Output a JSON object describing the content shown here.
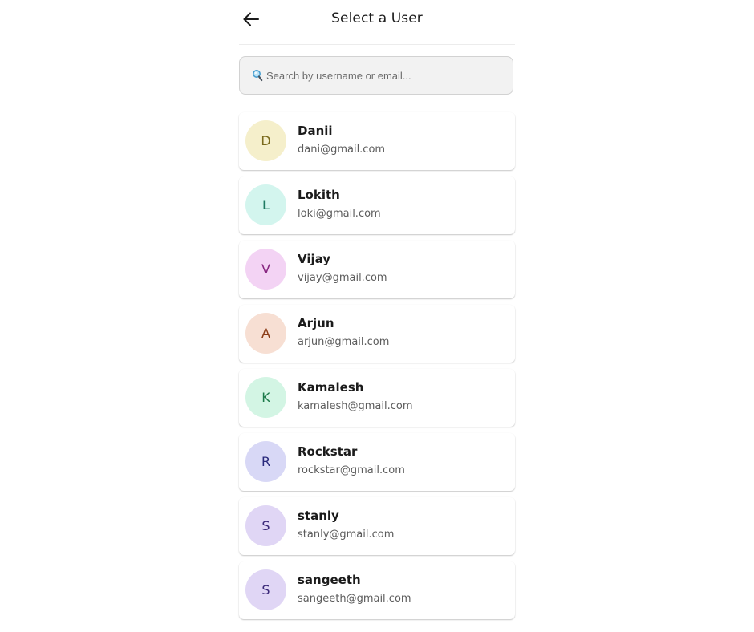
{
  "header": {
    "title": "Select a User",
    "back_icon": "arrow-left-icon"
  },
  "search": {
    "placeholder": "Search by username or email...",
    "value": "",
    "icon": "magnifier-icon"
  },
  "users": [
    {
      "initial": "D",
      "name": "Danii",
      "email": "dani@gmail.com",
      "avatar_bg": "#f5efcb",
      "avatar_fg": "#7a6a1c"
    },
    {
      "initial": "L",
      "name": "Lokith",
      "email": "loki@gmail.com",
      "avatar_bg": "#d3f5ee",
      "avatar_fg": "#1f7a62"
    },
    {
      "initial": "V",
      "name": "Vijay",
      "email": "vijay@gmail.com",
      "avatar_bg": "#f3d3f4",
      "avatar_fg": "#86247f"
    },
    {
      "initial": "A",
      "name": "Arjun",
      "email": "arjun@gmail.com",
      "avatar_bg": "#f7dfd3",
      "avatar_fg": "#8a3a14"
    },
    {
      "initial": "K",
      "name": "Kamalesh",
      "email": "kamalesh@gmail.com",
      "avatar_bg": "#d3f5e4",
      "avatar_fg": "#1c7a4a"
    },
    {
      "initial": "R",
      "name": "Rockstar",
      "email": "rockstar@gmail.com",
      "avatar_bg": "#d8d8f6",
      "avatar_fg": "#2a2a7c"
    },
    {
      "initial": "S",
      "name": "stanly",
      "email": "stanly@gmail.com",
      "avatar_bg": "#e0d6f5",
      "avatar_fg": "#3c2a7a"
    },
    {
      "initial": "S",
      "name": "sangeeth",
      "email": "sangeeth@gmail.com",
      "avatar_bg": "#e0d6f5",
      "avatar_fg": "#3c2a7a"
    }
  ]
}
